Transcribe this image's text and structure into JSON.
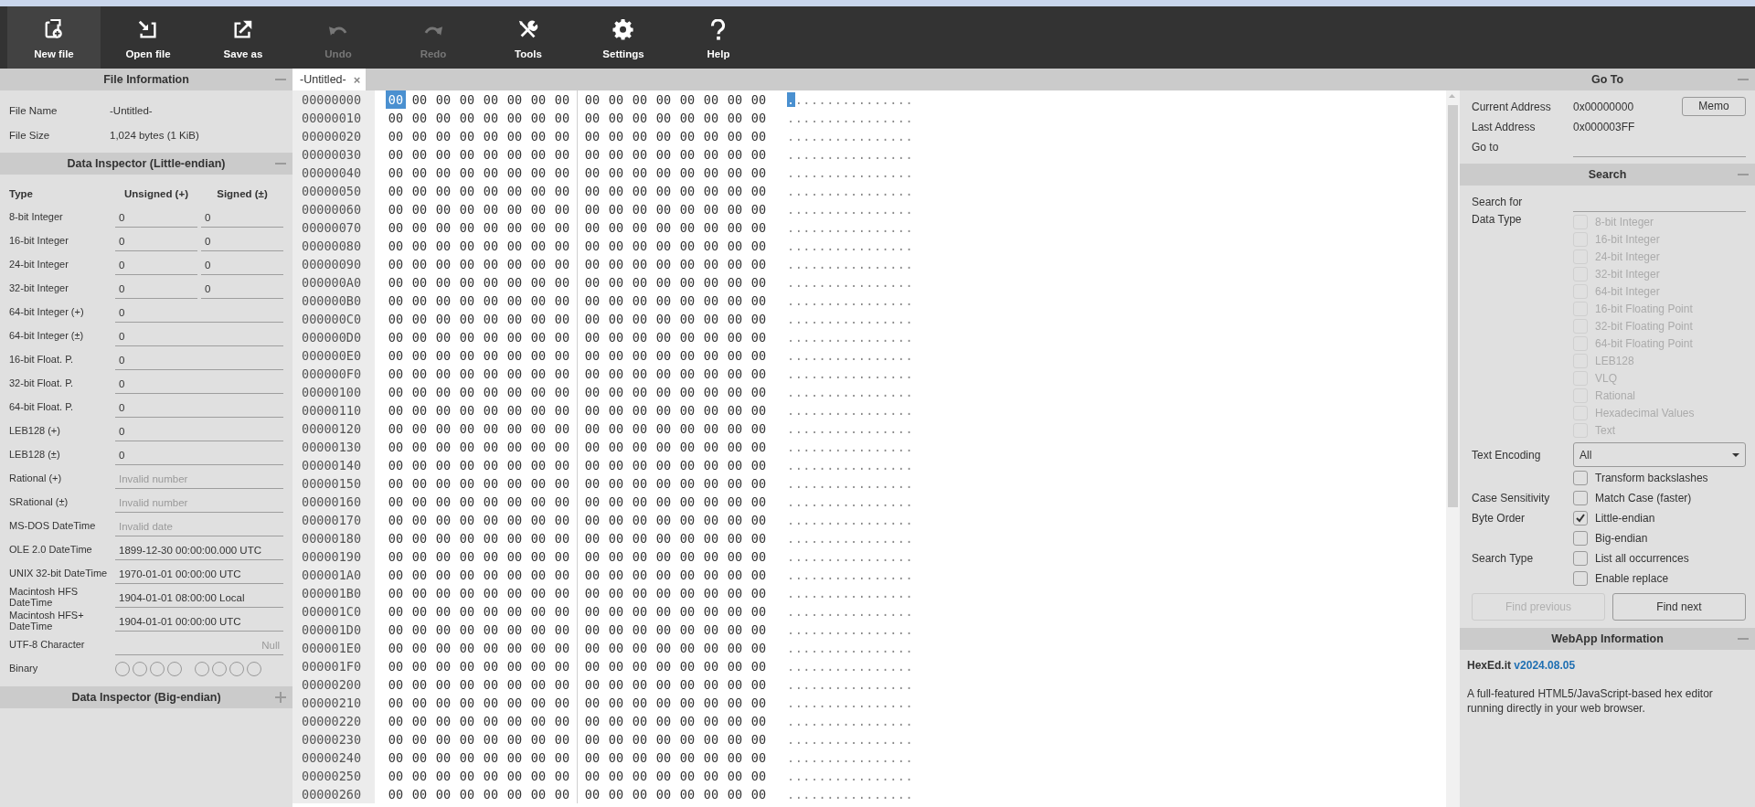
{
  "toolbar": [
    {
      "label": "New file",
      "selected": true,
      "disabled": false
    },
    {
      "label": "Open file",
      "selected": false,
      "disabled": false
    },
    {
      "label": "Save as",
      "selected": false,
      "disabled": false
    },
    {
      "label": "Undo",
      "selected": false,
      "disabled": true
    },
    {
      "label": "Redo",
      "selected": false,
      "disabled": true
    },
    {
      "label": "Tools",
      "selected": false,
      "disabled": false
    },
    {
      "label": "Settings",
      "selected": false,
      "disabled": false
    },
    {
      "label": "Help",
      "selected": false,
      "disabled": false
    }
  ],
  "file_information": {
    "title": "File Information",
    "expanded": true,
    "fields": [
      {
        "label": "File Name",
        "value": "-Untitled-"
      },
      {
        "label": "File Size",
        "value": "1,024 bytes (1 KiB)"
      }
    ]
  },
  "data_inspector_little_endian": {
    "title": "Data Inspector (Little-endian)",
    "expanded": true,
    "columns": [
      "Type",
      "Unsigned (+)",
      "Signed (±)"
    ],
    "rows": [
      {
        "kind": "pair",
        "label": "8-bit Integer",
        "values": [
          "0",
          "0"
        ]
      },
      {
        "kind": "pair",
        "label": "16-bit Integer",
        "values": [
          "0",
          "0"
        ]
      },
      {
        "kind": "pair",
        "label": "24-bit Integer",
        "values": [
          "0",
          "0"
        ]
      },
      {
        "kind": "pair",
        "label": "32-bit Integer",
        "values": [
          "0",
          "0"
        ]
      },
      {
        "kind": "single",
        "label": "64-bit Integer (+)",
        "value": "0"
      },
      {
        "kind": "single",
        "label": "64-bit Integer (±)",
        "value": "0"
      },
      {
        "kind": "single",
        "label": "16-bit Float. P.",
        "value": "0"
      },
      {
        "kind": "single",
        "label": "32-bit Float. P.",
        "value": "0"
      },
      {
        "kind": "single",
        "label": "64-bit Float. P.",
        "value": "0"
      },
      {
        "kind": "single",
        "label": "LEB128 (+)",
        "value": "0"
      },
      {
        "kind": "single",
        "label": "LEB128 (±)",
        "value": "0"
      },
      {
        "kind": "single",
        "label": "Rational (+)",
        "placeholder": "Invalid number"
      },
      {
        "kind": "single",
        "label": "SRational (±)",
        "placeholder": "Invalid number"
      },
      {
        "kind": "single",
        "label": "MS-DOS DateTime",
        "placeholder": "Invalid date"
      },
      {
        "kind": "single",
        "label": "OLE 2.0 DateTime",
        "value": "1899-12-30 00:00:00.000 UTC"
      },
      {
        "kind": "single",
        "label": "UNIX 32-bit DateTime",
        "value": "1970-01-01 00:00:00 UTC"
      },
      {
        "kind": "single",
        "label": "Macintosh HFS DateTime",
        "value": "1904-01-01 08:00:00 Local"
      },
      {
        "kind": "single",
        "label": "Macintosh HFS+ DateTime",
        "value": "1904-01-01 00:00:00 UTC"
      },
      {
        "kind": "character",
        "label": "UTF-8 Character",
        "placeholder": "Null"
      },
      {
        "kind": "binary",
        "label": "Binary",
        "bits": [
          false,
          false,
          false,
          false,
          false,
          false,
          false,
          false
        ]
      }
    ]
  },
  "data_inspector_big_endian": {
    "title": "Data Inspector (Big-endian)",
    "expanded": false
  },
  "tabs": [
    {
      "label": "-Untitled-",
      "selected": true,
      "close": "×"
    }
  ],
  "hex_view": {
    "rows": [
      {
        "address": "00000000",
        "selected": true,
        "bytes": [
          "00",
          "00",
          "00",
          "00",
          "00",
          "00",
          "00",
          "00",
          "00",
          "00",
          "00",
          "00",
          "00",
          "00",
          "00",
          "00"
        ],
        "text": "................"
      },
      {
        "address": "00000010",
        "selected": false,
        "bytes": [
          "00",
          "00",
          "00",
          "00",
          "00",
          "00",
          "00",
          "00",
          "00",
          "00",
          "00",
          "00",
          "00",
          "00",
          "00",
          "00"
        ],
        "text": "................"
      },
      {
        "address": "00000020",
        "selected": false,
        "bytes": [
          "00",
          "00",
          "00",
          "00",
          "00",
          "00",
          "00",
          "00",
          "00",
          "00",
          "00",
          "00",
          "00",
          "00",
          "00",
          "00"
        ],
        "text": "................"
      },
      {
        "address": "00000030",
        "selected": false,
        "bytes": [
          "00",
          "00",
          "00",
          "00",
          "00",
          "00",
          "00",
          "00",
          "00",
          "00",
          "00",
          "00",
          "00",
          "00",
          "00",
          "00"
        ],
        "text": "................"
      },
      {
        "address": "00000040",
        "selected": false,
        "bytes": [
          "00",
          "00",
          "00",
          "00",
          "00",
          "00",
          "00",
          "00",
          "00",
          "00",
          "00",
          "00",
          "00",
          "00",
          "00",
          "00"
        ],
        "text": "................"
      },
      {
        "address": "00000050",
        "selected": false,
        "bytes": [
          "00",
          "00",
          "00",
          "00",
          "00",
          "00",
          "00",
          "00",
          "00",
          "00",
          "00",
          "00",
          "00",
          "00",
          "00",
          "00"
        ],
        "text": "................"
      },
      {
        "address": "00000060",
        "selected": false,
        "bytes": [
          "00",
          "00",
          "00",
          "00",
          "00",
          "00",
          "00",
          "00",
          "00",
          "00",
          "00",
          "00",
          "00",
          "00",
          "00",
          "00"
        ],
        "text": "................"
      },
      {
        "address": "00000070",
        "selected": false,
        "bytes": [
          "00",
          "00",
          "00",
          "00",
          "00",
          "00",
          "00",
          "00",
          "00",
          "00",
          "00",
          "00",
          "00",
          "00",
          "00",
          "00"
        ],
        "text": "................"
      },
      {
        "address": "00000080",
        "selected": false,
        "bytes": [
          "00",
          "00",
          "00",
          "00",
          "00",
          "00",
          "00",
          "00",
          "00",
          "00",
          "00",
          "00",
          "00",
          "00",
          "00",
          "00"
        ],
        "text": "................"
      },
      {
        "address": "00000090",
        "selected": false,
        "bytes": [
          "00",
          "00",
          "00",
          "00",
          "00",
          "00",
          "00",
          "00",
          "00",
          "00",
          "00",
          "00",
          "00",
          "00",
          "00",
          "00"
        ],
        "text": "................"
      },
      {
        "address": "000000A0",
        "selected": false,
        "bytes": [
          "00",
          "00",
          "00",
          "00",
          "00",
          "00",
          "00",
          "00",
          "00",
          "00",
          "00",
          "00",
          "00",
          "00",
          "00",
          "00"
        ],
        "text": "................"
      },
      {
        "address": "000000B0",
        "selected": false,
        "bytes": [
          "00",
          "00",
          "00",
          "00",
          "00",
          "00",
          "00",
          "00",
          "00",
          "00",
          "00",
          "00",
          "00",
          "00",
          "00",
          "00"
        ],
        "text": "................"
      },
      {
        "address": "000000C0",
        "selected": false,
        "bytes": [
          "00",
          "00",
          "00",
          "00",
          "00",
          "00",
          "00",
          "00",
          "00",
          "00",
          "00",
          "00",
          "00",
          "00",
          "00",
          "00"
        ],
        "text": "................"
      },
      {
        "address": "000000D0",
        "selected": false,
        "bytes": [
          "00",
          "00",
          "00",
          "00",
          "00",
          "00",
          "00",
          "00",
          "00",
          "00",
          "00",
          "00",
          "00",
          "00",
          "00",
          "00"
        ],
        "text": "................"
      },
      {
        "address": "000000E0",
        "selected": false,
        "bytes": [
          "00",
          "00",
          "00",
          "00",
          "00",
          "00",
          "00",
          "00",
          "00",
          "00",
          "00",
          "00",
          "00",
          "00",
          "00",
          "00"
        ],
        "text": "................"
      },
      {
        "address": "000000F0",
        "selected": false,
        "bytes": [
          "00",
          "00",
          "00",
          "00",
          "00",
          "00",
          "00",
          "00",
          "00",
          "00",
          "00",
          "00",
          "00",
          "00",
          "00",
          "00"
        ],
        "text": "................"
      },
      {
        "address": "00000100",
        "selected": false,
        "bytes": [
          "00",
          "00",
          "00",
          "00",
          "00",
          "00",
          "00",
          "00",
          "00",
          "00",
          "00",
          "00",
          "00",
          "00",
          "00",
          "00"
        ],
        "text": "................"
      },
      {
        "address": "00000110",
        "selected": false,
        "bytes": [
          "00",
          "00",
          "00",
          "00",
          "00",
          "00",
          "00",
          "00",
          "00",
          "00",
          "00",
          "00",
          "00",
          "00",
          "00",
          "00"
        ],
        "text": "................"
      },
      {
        "address": "00000120",
        "selected": false,
        "bytes": [
          "00",
          "00",
          "00",
          "00",
          "00",
          "00",
          "00",
          "00",
          "00",
          "00",
          "00",
          "00",
          "00",
          "00",
          "00",
          "00"
        ],
        "text": "................"
      },
      {
        "address": "00000130",
        "selected": false,
        "bytes": [
          "00",
          "00",
          "00",
          "00",
          "00",
          "00",
          "00",
          "00",
          "00",
          "00",
          "00",
          "00",
          "00",
          "00",
          "00",
          "00"
        ],
        "text": "................"
      },
      {
        "address": "00000140",
        "selected": false,
        "bytes": [
          "00",
          "00",
          "00",
          "00",
          "00",
          "00",
          "00",
          "00",
          "00",
          "00",
          "00",
          "00",
          "00",
          "00",
          "00",
          "00"
        ],
        "text": "................"
      },
      {
        "address": "00000150",
        "selected": false,
        "bytes": [
          "00",
          "00",
          "00",
          "00",
          "00",
          "00",
          "00",
          "00",
          "00",
          "00",
          "00",
          "00",
          "00",
          "00",
          "00",
          "00"
        ],
        "text": "................"
      },
      {
        "address": "00000160",
        "selected": false,
        "bytes": [
          "00",
          "00",
          "00",
          "00",
          "00",
          "00",
          "00",
          "00",
          "00",
          "00",
          "00",
          "00",
          "00",
          "00",
          "00",
          "00"
        ],
        "text": "................"
      },
      {
        "address": "00000170",
        "selected": false,
        "bytes": [
          "00",
          "00",
          "00",
          "00",
          "00",
          "00",
          "00",
          "00",
          "00",
          "00",
          "00",
          "00",
          "00",
          "00",
          "00",
          "00"
        ],
        "text": "................"
      },
      {
        "address": "00000180",
        "selected": false,
        "bytes": [
          "00",
          "00",
          "00",
          "00",
          "00",
          "00",
          "00",
          "00",
          "00",
          "00",
          "00",
          "00",
          "00",
          "00",
          "00",
          "00"
        ],
        "text": "................"
      },
      {
        "address": "00000190",
        "selected": false,
        "bytes": [
          "00",
          "00",
          "00",
          "00",
          "00",
          "00",
          "00",
          "00",
          "00",
          "00",
          "00",
          "00",
          "00",
          "00",
          "00",
          "00"
        ],
        "text": "................"
      },
      {
        "address": "000001A0",
        "selected": false,
        "bytes": [
          "00",
          "00",
          "00",
          "00",
          "00",
          "00",
          "00",
          "00",
          "00",
          "00",
          "00",
          "00",
          "00",
          "00",
          "00",
          "00"
        ],
        "text": "................"
      },
      {
        "address": "000001B0",
        "selected": false,
        "bytes": [
          "00",
          "00",
          "00",
          "00",
          "00",
          "00",
          "00",
          "00",
          "00",
          "00",
          "00",
          "00",
          "00",
          "00",
          "00",
          "00"
        ],
        "text": "................"
      },
      {
        "address": "000001C0",
        "selected": false,
        "bytes": [
          "00",
          "00",
          "00",
          "00",
          "00",
          "00",
          "00",
          "00",
          "00",
          "00",
          "00",
          "00",
          "00",
          "00",
          "00",
          "00"
        ],
        "text": "................"
      },
      {
        "address": "000001D0",
        "selected": false,
        "bytes": [
          "00",
          "00",
          "00",
          "00",
          "00",
          "00",
          "00",
          "00",
          "00",
          "00",
          "00",
          "00",
          "00",
          "00",
          "00",
          "00"
        ],
        "text": "................"
      },
      {
        "address": "000001E0",
        "selected": false,
        "bytes": [
          "00",
          "00",
          "00",
          "00",
          "00",
          "00",
          "00",
          "00",
          "00",
          "00",
          "00",
          "00",
          "00",
          "00",
          "00",
          "00"
        ],
        "text": "................"
      },
      {
        "address": "000001F0",
        "selected": false,
        "bytes": [
          "00",
          "00",
          "00",
          "00",
          "00",
          "00",
          "00",
          "00",
          "00",
          "00",
          "00",
          "00",
          "00",
          "00",
          "00",
          "00"
        ],
        "text": "................"
      },
      {
        "address": "00000200",
        "selected": false,
        "bytes": [
          "00",
          "00",
          "00",
          "00",
          "00",
          "00",
          "00",
          "00",
          "00",
          "00",
          "00",
          "00",
          "00",
          "00",
          "00",
          "00"
        ],
        "text": "................"
      },
      {
        "address": "00000210",
        "selected": false,
        "bytes": [
          "00",
          "00",
          "00",
          "00",
          "00",
          "00",
          "00",
          "00",
          "00",
          "00",
          "00",
          "00",
          "00",
          "00",
          "00",
          "00"
        ],
        "text": "................"
      },
      {
        "address": "00000220",
        "selected": false,
        "bytes": [
          "00",
          "00",
          "00",
          "00",
          "00",
          "00",
          "00",
          "00",
          "00",
          "00",
          "00",
          "00",
          "00",
          "00",
          "00",
          "00"
        ],
        "text": "................"
      },
      {
        "address": "00000230",
        "selected": false,
        "bytes": [
          "00",
          "00",
          "00",
          "00",
          "00",
          "00",
          "00",
          "00",
          "00",
          "00",
          "00",
          "00",
          "00",
          "00",
          "00",
          "00"
        ],
        "text": "................"
      },
      {
        "address": "00000240",
        "selected": false,
        "bytes": [
          "00",
          "00",
          "00",
          "00",
          "00",
          "00",
          "00",
          "00",
          "00",
          "00",
          "00",
          "00",
          "00",
          "00",
          "00",
          "00"
        ],
        "text": "................"
      },
      {
        "address": "00000250",
        "selected": false,
        "bytes": [
          "00",
          "00",
          "00",
          "00",
          "00",
          "00",
          "00",
          "00",
          "00",
          "00",
          "00",
          "00",
          "00",
          "00",
          "00",
          "00"
        ],
        "text": "................"
      },
      {
        "address": "00000260",
        "selected": false,
        "bytes": [
          "00",
          "00",
          "00",
          "00",
          "00",
          "00",
          "00",
          "00",
          "00",
          "00",
          "00",
          "00",
          "00",
          "00",
          "00",
          "00"
        ],
        "text": "................"
      }
    ]
  },
  "go_to": {
    "title": "Go To",
    "expanded": true,
    "current_address": {
      "label": "Current Address",
      "value": "0x00000000"
    },
    "memo_button": "Memo",
    "last_address": {
      "label": "Last Address",
      "value": "0x000003FF"
    },
    "go_to_field": {
      "label": "Go to"
    }
  },
  "search": {
    "title": "Search",
    "expanded": true,
    "search_for": {
      "label": "Search for"
    },
    "data_type": {
      "label": "Data Type",
      "options": [
        {
          "label": "8-bit Integer",
          "checked": false,
          "disabled": true
        },
        {
          "label": "16-bit Integer",
          "checked": false,
          "disabled": true
        },
        {
          "label": "24-bit Integer",
          "checked": false,
          "disabled": true
        },
        {
          "label": "32-bit Integer",
          "checked": false,
          "disabled": true
        },
        {
          "label": "64-bit Integer",
          "checked": false,
          "disabled": true
        },
        {
          "label": "16-bit Floating Point",
          "checked": false,
          "disabled": true
        },
        {
          "label": "32-bit Floating Point",
          "checked": false,
          "disabled": true
        },
        {
          "label": "64-bit Floating Point",
          "checked": false,
          "disabled": true
        },
        {
          "label": "LEB128",
          "checked": false,
          "disabled": true
        },
        {
          "label": "VLQ",
          "checked": false,
          "disabled": true
        },
        {
          "label": "Rational",
          "checked": false,
          "disabled": true
        },
        {
          "label": "Hexadecimal Values",
          "checked": false,
          "disabled": true
        },
        {
          "label": "Text",
          "checked": false,
          "disabled": true
        }
      ]
    },
    "text_encoding": {
      "label": "Text Encoding",
      "value": "All"
    },
    "settings": [
      {
        "option": "Transform backslashes",
        "checked": false,
        "disabled": false
      },
      {
        "label": "Case Sensitivity",
        "option": "Match Case (faster)",
        "checked": false,
        "disabled": false
      },
      {
        "label": "Byte Order",
        "option": "Little-endian",
        "checked": true,
        "disabled": false
      },
      {
        "option": "Big-endian",
        "checked": false,
        "disabled": false
      },
      {
        "label": "Search Type",
        "option": "List all occurrences",
        "checked": false,
        "disabled": false
      },
      {
        "option": "Enable replace",
        "checked": false,
        "disabled": false
      }
    ],
    "buttons": [
      {
        "label": "Find previous",
        "disabled": true
      },
      {
        "label": "Find next",
        "disabled": false
      }
    ]
  },
  "webapp_information": {
    "title": "WebApp Information",
    "expanded": true,
    "name": "HexEd.it",
    "version": "v2024.08.05",
    "description": "A full-featured HTML5/JavaScript-based hex editor running directly in your web browser."
  }
}
